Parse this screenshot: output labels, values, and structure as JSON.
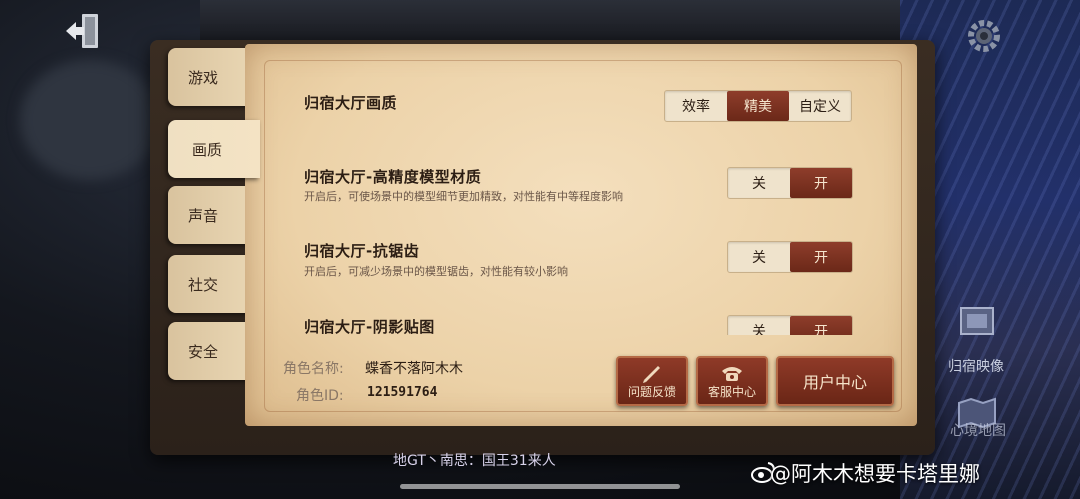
{
  "tabs": [
    {
      "label": "游戏",
      "active": false
    },
    {
      "label": "画质",
      "active": true
    },
    {
      "label": "声音",
      "active": false
    },
    {
      "label": "社交",
      "active": false
    },
    {
      "label": "安全",
      "active": false
    }
  ],
  "settings": {
    "quality": {
      "title": "归宿大厅画质",
      "options": [
        "效率",
        "精美",
        "自定义"
      ],
      "selected": "精美"
    },
    "model_material": {
      "title": "归宿大厅-高精度模型材质",
      "desc": "开启后，可使场景中的模型细节更加精致，对性能有中等程度影响",
      "off": "关",
      "on": "开",
      "value": "开"
    },
    "antialias": {
      "title": "归宿大厅-抗锯齿",
      "desc": "开启后，可减少场景中的模型锯齿，对性能有较小影响",
      "off": "关",
      "on": "开",
      "value": "开"
    },
    "shadow": {
      "title": "归宿大厅-阴影贴图",
      "off": "关",
      "on": "开",
      "value": "开"
    }
  },
  "footer": {
    "name_label": "角色名称:",
    "name_value": "蝶香不落阿木木",
    "id_label": "角色ID:",
    "id_value": "121591764",
    "feedback_label": "问题反馈",
    "service_label": "客服中心",
    "user_center_label": "用户中心"
  },
  "side": {
    "home_video": "归宿映像",
    "realm_map": "心境地图"
  },
  "chat_line": "地GT丶南思：国王31来人",
  "watermark": "@阿木木想要卡塔里娜",
  "colors": {
    "accent": "#7a2e1c",
    "paper": "#ecd2a8"
  }
}
